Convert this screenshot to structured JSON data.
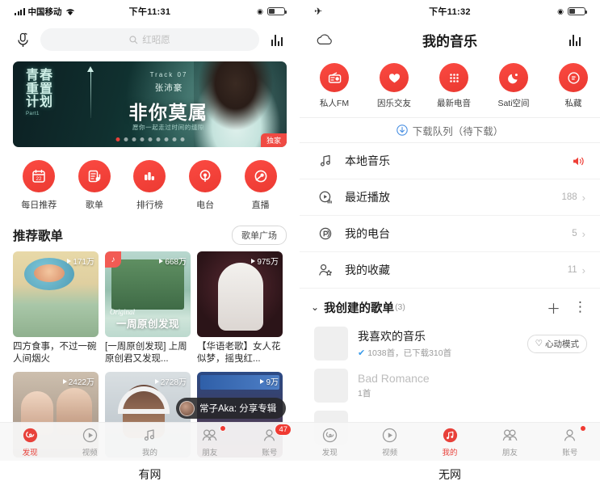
{
  "left_phone": {
    "caption": "有网",
    "status_bar": {
      "carrier": "中国移动",
      "wifi_icon": "wifi-icon",
      "time": "下午11:31",
      "lock_icon": "rotation-lock-icon",
      "battery_icon": "battery-icon"
    },
    "search_header": {
      "mic_icon": "microphone-icon",
      "search_placeholder": "红昭愿",
      "search_icon": "search-icon",
      "equalizer_icon": "equalizer-icon"
    },
    "banner": {
      "left_title_lines": [
        "青春",
        "重置",
        "计划"
      ],
      "part_label": "Part1",
      "track_label": "Track 07",
      "artist": "张沛豪",
      "song_title": "非你莫属",
      "subtitle": "愿你一起走过时间的缝隙",
      "badge": "独家",
      "dots_total": 9,
      "dots_active_index": 0
    },
    "quick_entries": [
      {
        "label": "每日推荐",
        "icon": "calendar-icon",
        "day": "22"
      },
      {
        "label": "歌单",
        "icon": "playlist-icon"
      },
      {
        "label": "排行榜",
        "icon": "ranking-bars-icon"
      },
      {
        "label": "电台",
        "icon": "radio-icon"
      },
      {
        "label": "直播",
        "icon": "live-icon"
      }
    ],
    "section": {
      "title": "推荐歌单",
      "action_label": "歌单广场"
    },
    "playlists": [
      {
        "title": "四方食事，不过一碗人间烟火",
        "plays": "171万",
        "art": "art1",
        "tag": "",
        "overlay": "",
        "overlay_en": ""
      },
      {
        "title": "[一周原创发现] 上周原创君又发现...",
        "plays": "668万",
        "art": "art2",
        "tag": "原创",
        "overlay": "一周原创发现",
        "overlay_en": "Original"
      },
      {
        "title": "【华语老歌】女人花似梦，摇曳红...",
        "plays": "975万",
        "art": "art3",
        "tag": "",
        "overlay": "",
        "overlay_en": ""
      },
      {
        "title": "",
        "plays": "2422万",
        "art": "art4",
        "tag": "",
        "overlay": "",
        "overlay_en": ""
      },
      {
        "title": "",
        "plays": "2728万",
        "art": "art5",
        "tag": "",
        "overlay": "",
        "overlay_en": ""
      },
      {
        "title": "",
        "plays": "9万",
        "art": "art6",
        "tag": "",
        "overlay": "",
        "overlay_en": ""
      }
    ],
    "toast": {
      "text": "常子Aka: 分享专辑",
      "avatar_icon": "user-avatar"
    },
    "tabbar": [
      {
        "label": "发现",
        "icon": "discover-icon",
        "active": true,
        "badge": "",
        "dot": false
      },
      {
        "label": "视频",
        "icon": "video-play-icon",
        "active": false,
        "badge": "",
        "dot": false
      },
      {
        "label": "我的",
        "icon": "music-note-icon",
        "active": false,
        "badge": "",
        "dot": false
      },
      {
        "label": "朋友",
        "icon": "friends-icon",
        "active": false,
        "badge": "",
        "dot": true
      },
      {
        "label": "账号",
        "icon": "account-icon",
        "active": false,
        "badge": "47",
        "dot": false
      }
    ]
  },
  "right_phone": {
    "caption": "无网",
    "status_bar": {
      "airplane_icon": "airplane-mode-icon",
      "time": "下午11:32",
      "lock_icon": "rotation-lock-icon",
      "battery_icon": "battery-icon"
    },
    "header": {
      "title": "我的音乐",
      "left_icon": "cloud-icon",
      "right_icon": "equalizer-icon"
    },
    "quick_entries": [
      {
        "label": "私人FM",
        "icon": "radio-fm-icon"
      },
      {
        "label": "因乐交友",
        "icon": "heart-icon"
      },
      {
        "label": "最新电音",
        "icon": "grid-dots-icon"
      },
      {
        "label": "Sati空间",
        "icon": "moon-icon"
      },
      {
        "label": "私藏",
        "icon": "collection-icon"
      }
    ],
    "download_row": {
      "icon": "download-icon",
      "label": "下载队列（待下载）"
    },
    "menu_rows": [
      {
        "label": "本地音乐",
        "icon": "music-note-icon",
        "count": "",
        "trailing": "speaker-icon"
      },
      {
        "label": "最近播放",
        "icon": "recent-play-icon",
        "count": "188",
        "trailing": "chevron-right-icon"
      },
      {
        "label": "我的电台",
        "icon": "radio-signal-icon",
        "count": "5",
        "trailing": "chevron-right-icon"
      },
      {
        "label": "我的收藏",
        "icon": "person-star-icon",
        "count": "11",
        "trailing": "chevron-right-icon"
      }
    ],
    "group": {
      "caret_icon": "chevron-down-icon",
      "title": "我创建的歌单",
      "count": "(3)",
      "add_icon": "plus-icon",
      "more_icon": "more-vertical-icon"
    },
    "playlists": [
      {
        "name": "我喜欢的音乐",
        "meta": "1038首，已下载310首",
        "meta_icon": "downloaded-check-icon",
        "chip": "心动模式",
        "chip_icon": "heart-outline-icon",
        "dim": false
      },
      {
        "name": "Bad Romance",
        "meta": "1首",
        "meta_icon": "",
        "chip": "",
        "chip_icon": "",
        "dim": true
      }
    ],
    "tabbar": [
      {
        "label": "发现",
        "icon": "discover-icon",
        "active": false,
        "badge": "",
        "dot": false
      },
      {
        "label": "视频",
        "icon": "video-play-icon",
        "active": false,
        "badge": "",
        "dot": false
      },
      {
        "label": "我的",
        "icon": "music-note-icon",
        "active": true,
        "badge": "",
        "dot": false
      },
      {
        "label": "朋友",
        "icon": "friends-icon",
        "active": false,
        "badge": "",
        "dot": false
      },
      {
        "label": "账号",
        "icon": "account-icon",
        "active": false,
        "badge": "",
        "dot": true
      }
    ]
  },
  "theme": {
    "accent": "#e8413a",
    "accent_soft": "#fb4a42",
    "text": "#1c1c1c",
    "muted": "#9a9a9a",
    "blue": "#4a90e2"
  }
}
